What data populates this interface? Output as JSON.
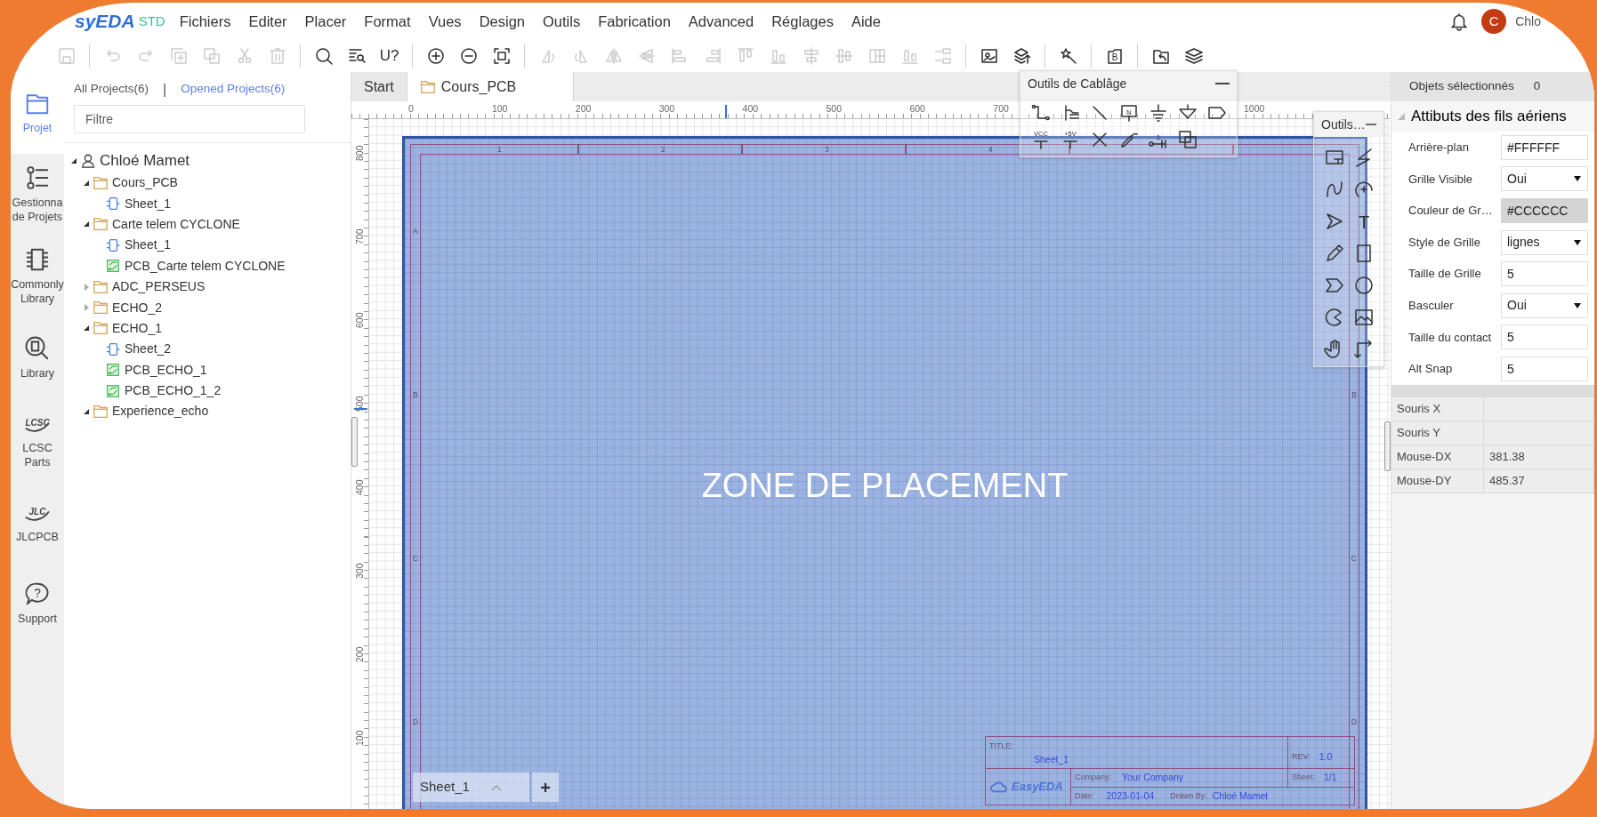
{
  "menubar": {
    "logo": "syEDA",
    "edition": "STD",
    "menus": [
      "Fichiers",
      "Editer",
      "Placer",
      "Format",
      "Vues",
      "Design",
      "Outils",
      "Fabrication",
      "Advanced",
      "Réglages",
      "Aide"
    ],
    "avatar": "C",
    "user": "Chlo"
  },
  "toolbar": [
    [
      {
        "kind": "save",
        "disabled": true
      }
    ],
    [
      {
        "kind": "undo",
        "disabled": true
      },
      {
        "kind": "redo",
        "disabled": true
      },
      {
        "kind": "copy",
        "disabled": true
      },
      {
        "kind": "paste",
        "disabled": true
      },
      {
        "kind": "cut",
        "disabled": true
      },
      {
        "kind": "delete",
        "disabled": true
      }
    ],
    [
      {
        "kind": "search",
        "disabled": false
      },
      {
        "kind": "find-list",
        "disabled": false
      },
      {
        "kind": "find-part",
        "text": "U?",
        "disabled": false
      }
    ],
    [
      {
        "kind": "zoom-in",
        "disabled": false
      },
      {
        "kind": "zoom-out",
        "disabled": false
      },
      {
        "kind": "fit",
        "disabled": false
      }
    ],
    [
      {
        "kind": "rotate-left",
        "disabled": true
      },
      {
        "kind": "rotate-right",
        "disabled": true
      },
      {
        "kind": "flip-h",
        "disabled": true
      },
      {
        "kind": "flip-v",
        "disabled": true
      },
      {
        "kind": "align-left",
        "disabled": true
      },
      {
        "kind": "align-right",
        "disabled": true
      },
      {
        "kind": "align-top",
        "disabled": true
      },
      {
        "kind": "align-bottom",
        "disabled": true
      },
      {
        "kind": "align-center-v",
        "disabled": true
      },
      {
        "kind": "align-center-h",
        "disabled": true
      },
      {
        "kind": "grid",
        "disabled": true
      },
      {
        "kind": "distribute-h",
        "disabled": true
      },
      {
        "kind": "distribute-v",
        "disabled": true
      }
    ],
    [
      {
        "kind": "board-image",
        "disabled": false
      },
      {
        "kind": "layers-up",
        "disabled": false
      }
    ],
    [
      {
        "kind": "wand",
        "disabled": false
      }
    ],
    [
      {
        "kind": "b-box",
        "text": "B",
        "disabled": false
      }
    ],
    [
      {
        "kind": "folder-back",
        "disabled": false
      },
      {
        "kind": "layers",
        "disabled": false
      }
    ]
  ],
  "rail": [
    {
      "label": "Projet",
      "kind": "folder",
      "selected": true
    },
    {
      "label": "Gestionna\nde Projets",
      "kind": "list",
      "selected": false
    },
    {
      "label": "Commonly\nLibrary",
      "kind": "chip",
      "selected": false
    },
    {
      "label": "Library",
      "kind": "library",
      "selected": false
    },
    {
      "label": "LCSC\nParts",
      "kind": "logo",
      "icon_text": "LCSC",
      "selected": false
    },
    {
      "label": "JLCPCB",
      "kind": "logo",
      "icon_text": "JLC",
      "selected": false
    },
    {
      "label": "Support",
      "kind": "help",
      "icon_text": "?",
      "selected": false
    }
  ],
  "project_panel": {
    "tabs": [
      {
        "label": "All Projects(6)",
        "selected": false
      },
      {
        "label": "Opened Projects(6)",
        "selected": true
      }
    ],
    "separator": "|",
    "filter": {
      "placeholder": "Filtre"
    },
    "tree": {
      "label": "Chloé Mamet",
      "kind": "user",
      "expanded": true,
      "children": [
        {
          "label": "Cours_PCB",
          "kind": "project",
          "expanded": true,
          "children": [
            {
              "label": "Sheet_1",
              "kind": "schematic"
            }
          ]
        },
        {
          "label": "Carte telem CYCLONE",
          "kind": "project",
          "expanded": true,
          "children": [
            {
              "label": "Sheet_1",
              "kind": "schematic"
            },
            {
              "label": "PCB_Carte telem CYCLONE",
              "kind": "pcb"
            }
          ]
        },
        {
          "label": "ADC_PERSEUS",
          "kind": "project",
          "expanded": false
        },
        {
          "label": "ECHO_2",
          "kind": "project",
          "expanded": false
        },
        {
          "label": "ECHO_1",
          "kind": "project",
          "expanded": true,
          "children": [
            {
              "label": "Sheet_2",
              "kind": "schematic"
            },
            {
              "label": "PCB_ECHO_1",
              "kind": "pcb"
            },
            {
              "label": "PCB_ECHO_1_2",
              "kind": "pcb"
            }
          ]
        },
        {
          "label": "Experience_echo",
          "kind": "project",
          "expanded": true
        }
      ]
    }
  },
  "editor": {
    "tabs": [
      {
        "label": "Start",
        "kind": "start",
        "selected": false
      },
      {
        "label": "Cours_PCB",
        "kind": "project",
        "selected": true
      }
    ],
    "top_ruler": [
      "0",
      "100",
      "200",
      "300",
      "400",
      "500",
      "600",
      "700",
      "1000"
    ],
    "side_ruler": [
      "800",
      "700",
      "600",
      "500",
      "400",
      "300",
      "200",
      "100"
    ],
    "sheet": {
      "columns": [
        "1",
        "2",
        "3",
        "4"
      ],
      "rows_left": [
        "A",
        "B",
        "C",
        "D"
      ],
      "rows_right": [
        "B",
        "C",
        "D"
      ],
      "overlay_text": "ZONE DE PLACEMENT",
      "title_block": {
        "title_label": "TITLE:",
        "title": "Sheet_1",
        "rev_label": "REV:",
        "rev": "1.0",
        "logo": "EasyEDA",
        "company_label": "Company:",
        "company": "Your Company",
        "sheet_label": "Sheet:",
        "sheet": "1/1",
        "date_label": "Date:",
        "date": "2023-01-04",
        "drawn_label": "Drawn By:",
        "drawn_by": "Chloé Mamet"
      }
    },
    "sheet_tabs": [
      {
        "label": "Sheet_1",
        "selected": true
      }
    ],
    "add_sheet": "+",
    "wiring_panel": {
      "title": "Outils de Cablâge",
      "tools": [
        {
          "kind": "wire"
        },
        {
          "kind": "bus"
        },
        {
          "kind": "line"
        },
        {
          "kind": "net-label",
          "text": "N"
        },
        {
          "kind": "ground"
        },
        {
          "kind": "net-port"
        },
        {
          "kind": "net-flag"
        },
        {
          "kind": "power",
          "text": "VCC"
        },
        {
          "kind": "power",
          "text": "+5V"
        },
        {
          "kind": "no-connect"
        },
        {
          "kind": "probe"
        },
        {
          "kind": "pin",
          "text": "1"
        },
        {
          "kind": "group"
        }
      ]
    },
    "drawing_panel": {
      "title": "Outils…",
      "tools": [
        {
          "kind": "frame"
        },
        {
          "kind": "zigzag"
        },
        {
          "kind": "curve"
        },
        {
          "kind": "arc"
        },
        {
          "kind": "arrowhead"
        },
        {
          "kind": "text",
          "text": "T"
        },
        {
          "kind": "pencil"
        },
        {
          "kind": "rectangle"
        },
        {
          "kind": "chevron"
        },
        {
          "kind": "circle"
        },
        {
          "kind": "pie"
        },
        {
          "kind": "image"
        },
        {
          "kind": "hand"
        },
        {
          "kind": "axis"
        }
      ]
    }
  },
  "properties": {
    "selected_label": "Objets sélectionnés",
    "selected_count": "0",
    "section": {
      "title": "Attibuts des fils aériens",
      "expanded": true
    },
    "fields": [
      {
        "label": "Arrière-plan",
        "kind": "input",
        "value": "#FFFFFF"
      },
      {
        "label": "Grille Visible",
        "kind": "select",
        "value": "Oui"
      },
      {
        "label": "Couleur de Gr…",
        "kind": "readonly",
        "value": "#CCCCCC"
      },
      {
        "label": "Style de Grille",
        "kind": "select",
        "value": "lignes"
      },
      {
        "label": "Taille de Grille",
        "kind": "input",
        "value": "5"
      },
      {
        "label": "Basculer",
        "kind": "select",
        "value": "Oui"
      },
      {
        "label": "Taille du contact",
        "kind": "input",
        "value": "5"
      },
      {
        "label": "Alt Snap",
        "kind": "input",
        "value": "5"
      }
    ],
    "readouts": [
      {
        "label": "Souris X"
      },
      {
        "label": "Souris Y"
      },
      {
        "label": "Mouse-DX",
        "value": "381.38"
      },
      {
        "label": "Mouse-DY",
        "value": "485.37"
      }
    ]
  }
}
